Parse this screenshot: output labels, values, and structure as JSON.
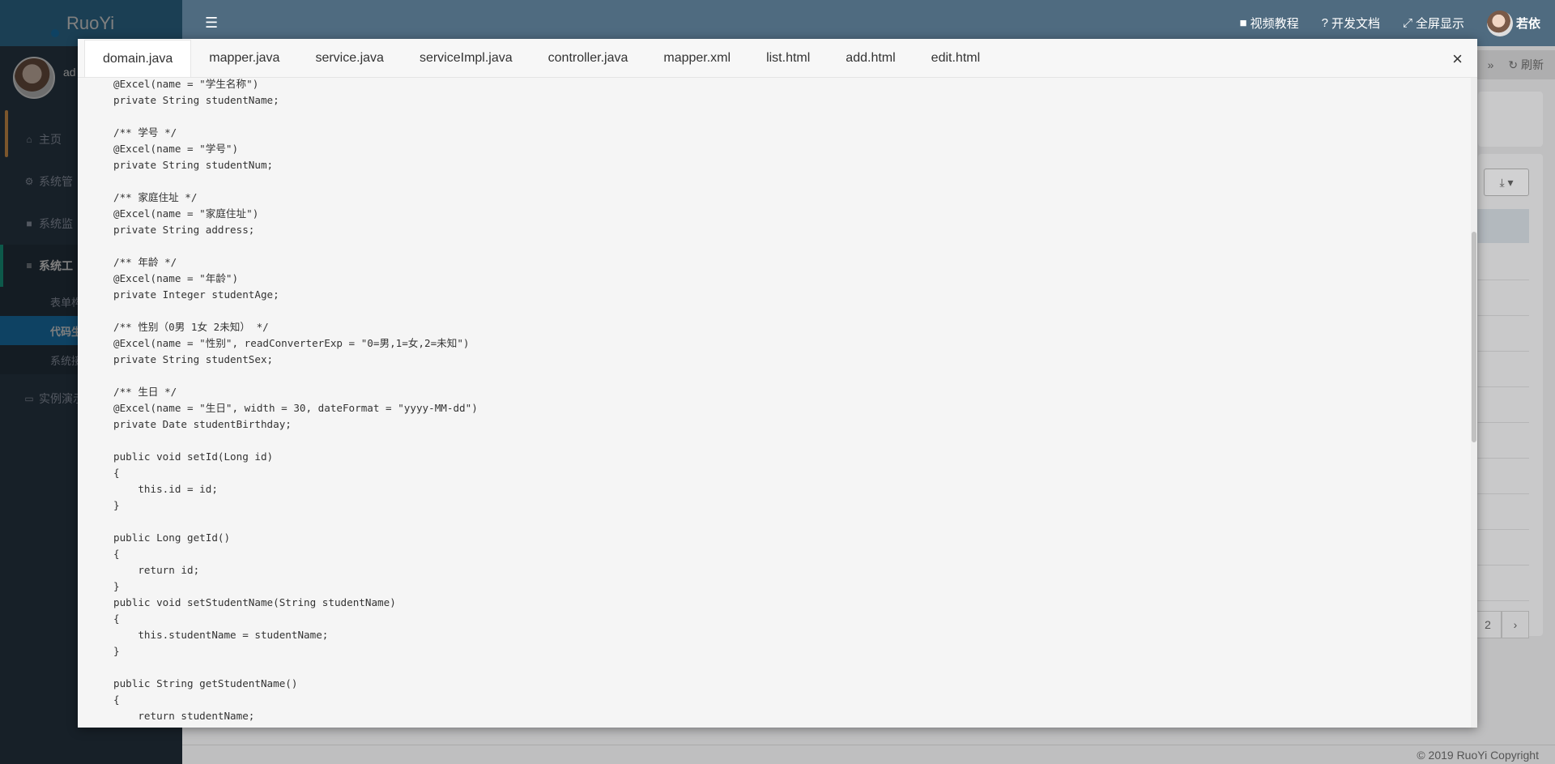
{
  "app": {
    "logo": "RuoYi",
    "user": "ad",
    "footer": "© 2019 RuoYi Copyright"
  },
  "header": {
    "links": [
      {
        "icon": "video-icon",
        "label": "视频教程"
      },
      {
        "icon": "question-icon",
        "label": "开发文档"
      },
      {
        "icon": "fullscreen-icon",
        "label": "全屏显示"
      }
    ],
    "user_name": "若依",
    "refresh_label": "刷新"
  },
  "sidebar": {
    "items": [
      {
        "icon": "home-icon",
        "label": "主页"
      },
      {
        "icon": "gear-icon",
        "label": "系统管"
      },
      {
        "icon": "video-icon",
        "label": "系统监"
      },
      {
        "icon": "bars-icon",
        "label": "系统工"
      }
    ],
    "subitems": [
      "表单构",
      "代码生",
      "系统接"
    ],
    "demo": {
      "icon": "monitor-icon",
      "label": "实例演示"
    }
  },
  "background": {
    "pager": [
      "2",
      "›"
    ]
  },
  "modal": {
    "tabs": [
      "domain.java",
      "mapper.java",
      "service.java",
      "serviceImpl.java",
      "controller.java",
      "mapper.xml",
      "list.html",
      "add.html",
      "edit.html"
    ],
    "active_tab": "domain.java",
    "close_label": "×",
    "code": "@Excel(name = \"学生名称\")\nprivate String studentName;\n\n/** 学号 */\n@Excel(name = \"学号\")\nprivate String studentNum;\n\n/** 家庭住址 */\n@Excel(name = \"家庭住址\")\nprivate String address;\n\n/** 年龄 */\n@Excel(name = \"年龄\")\nprivate Integer studentAge;\n\n/** 性别（0男 1女 2未知） */\n@Excel(name = \"性别\", readConverterExp = \"0=男,1=女,2=未知\")\nprivate String studentSex;\n\n/** 生日 */\n@Excel(name = \"生日\", width = 30, dateFormat = \"yyyy-MM-dd\")\nprivate Date studentBirthday;\n\npublic void setId(Long id)\n{\n    this.id = id;\n}\n\npublic Long getId()\n{\n    return id;\n}\npublic void setStudentName(String studentName)\n{\n    this.studentName = studentName;\n}\n\npublic String getStudentName()\n{\n    return studentName;\n}"
  }
}
